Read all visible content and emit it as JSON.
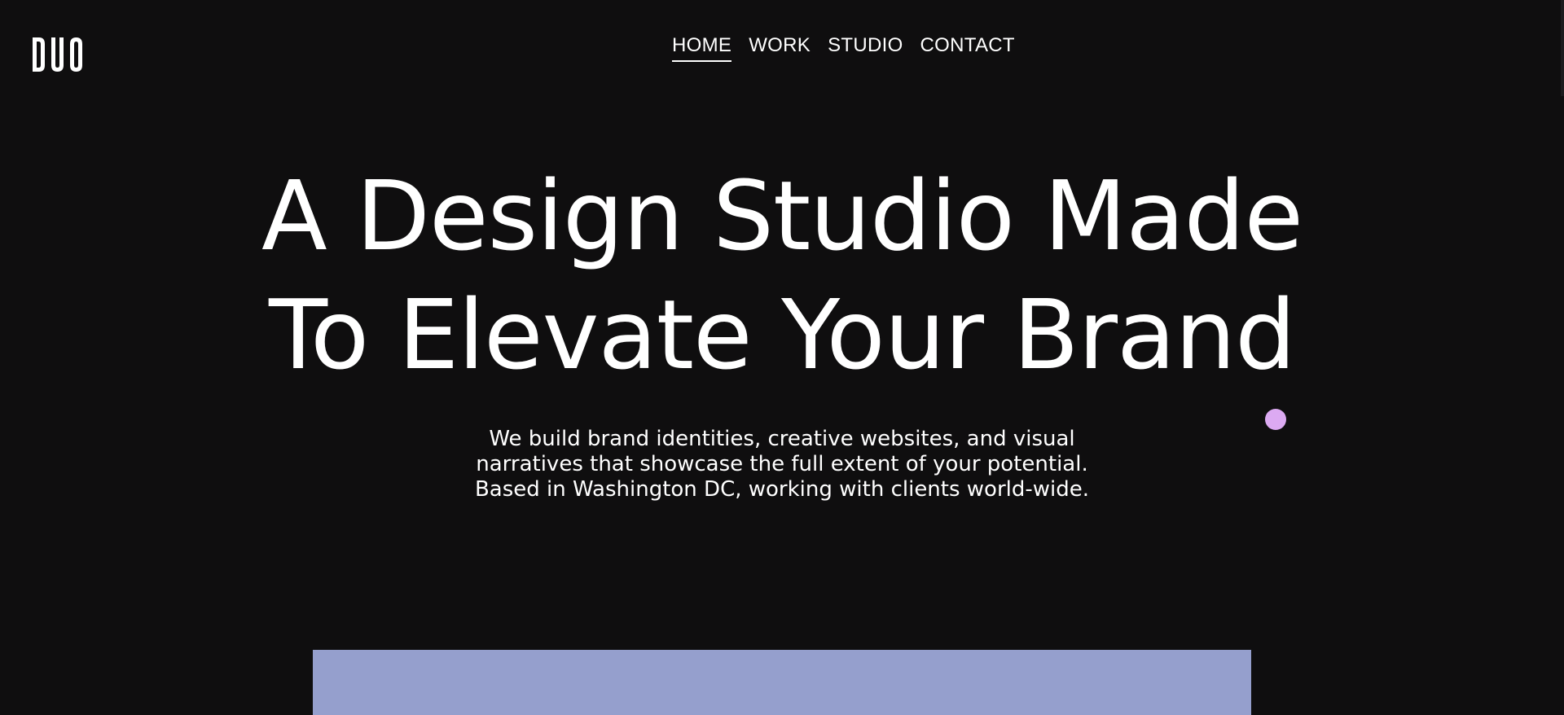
{
  "brand": {
    "logo_text": "DUO"
  },
  "nav": {
    "items": [
      {
        "label": "HOME",
        "active": true
      },
      {
        "label": "WORK",
        "active": false
      },
      {
        "label": "STUDIO",
        "active": false
      },
      {
        "label": "CONTACT",
        "active": false
      }
    ]
  },
  "hero": {
    "title_line_1": "A Design Studio Made",
    "title_line_2": "To Elevate Your Brand",
    "subtitle_line_1": "We build brand identities, creative websites, and visual",
    "subtitle_line_2": "narratives that showcase the full extent of your potential.",
    "subtitle_line_3": "Based in Washington DC, working with clients world-wide."
  },
  "colors": {
    "background": "#0f0e0f",
    "text": "#ffffff",
    "cursor_dot": "#dcaaf2",
    "feature_block": "#959fcd"
  }
}
